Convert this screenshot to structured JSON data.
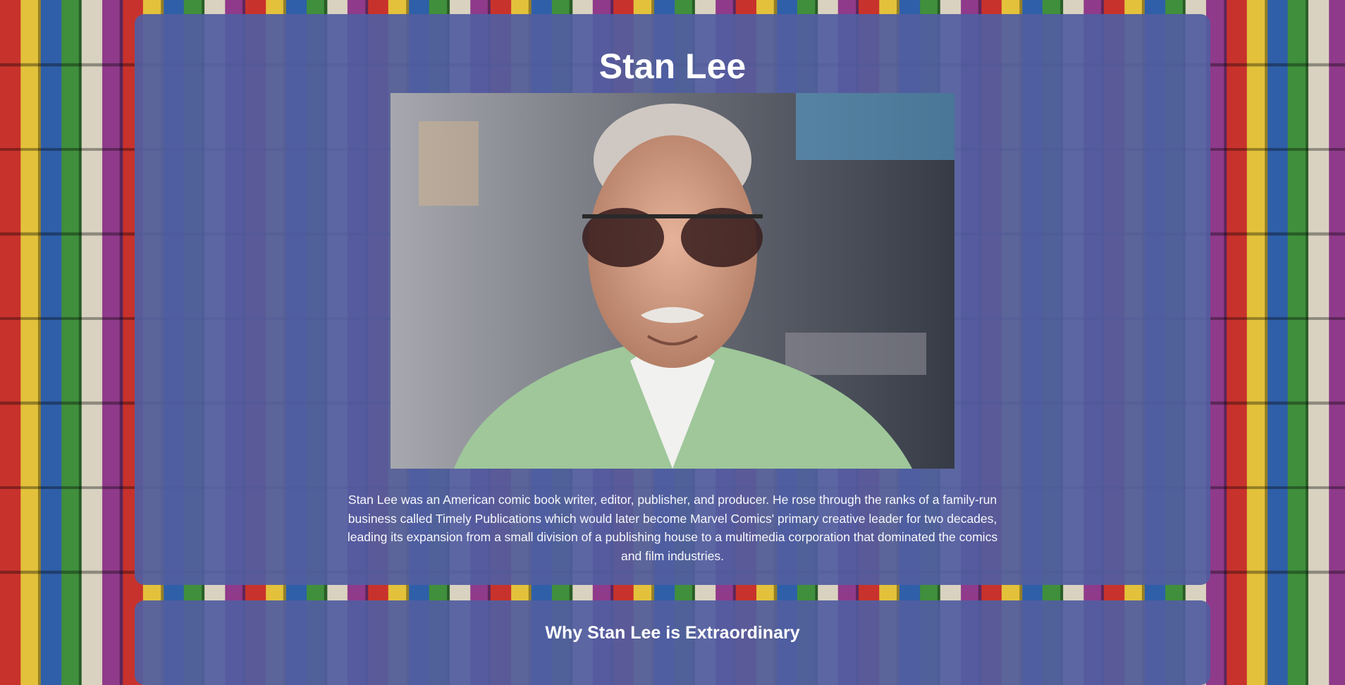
{
  "profile": {
    "name": "Stan Lee",
    "bio": "Stan Lee was an American comic book writer, editor, publisher, and producer. He rose through the ranks of a family-run business called Timely Publications which would later become Marvel Comics' primary creative leader for two decades, leading its expansion from a small division of a publishing house to a multimedia corporation that dominated the comics and film industries.",
    "photo_alt": "Stan Lee"
  },
  "sections": {
    "why_title": "Why Stan Lee is Extraordinary"
  },
  "colors": {
    "card_background": "#525ea0",
    "text": "#ffffff"
  }
}
